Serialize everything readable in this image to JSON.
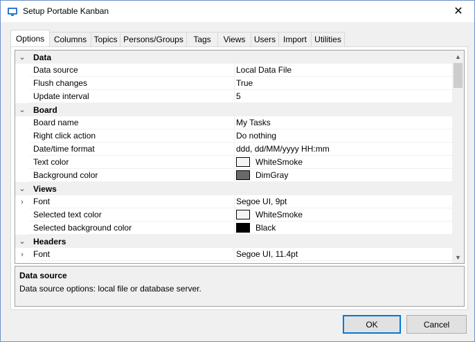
{
  "window": {
    "title": "Setup Portable Kanban",
    "close_glyph": "✕"
  },
  "tabs": [
    {
      "label": "Options"
    },
    {
      "label": "Columns"
    },
    {
      "label": "Topics"
    },
    {
      "label": "Persons/Groups"
    },
    {
      "label": "Tags"
    },
    {
      "label": "Views"
    },
    {
      "label": "Users"
    },
    {
      "label": "Import"
    },
    {
      "label": "Utilities"
    }
  ],
  "grid": {
    "rows": [
      {
        "type": "category",
        "expand_glyph": "⌄",
        "name": "Data"
      },
      {
        "type": "prop",
        "name": "Data source",
        "value": "Local Data File"
      },
      {
        "type": "prop",
        "name": "Flush changes",
        "value": "True"
      },
      {
        "type": "prop",
        "name": "Update interval",
        "value": "5"
      },
      {
        "type": "category",
        "expand_glyph": "⌄",
        "name": "Board"
      },
      {
        "type": "prop",
        "name": "Board name",
        "value": "My Tasks"
      },
      {
        "type": "prop",
        "name": "Right click action",
        "value": "Do nothing"
      },
      {
        "type": "prop",
        "name": "Date/time format",
        "value": "ddd, dd/MM/yyyy HH:mm"
      },
      {
        "type": "prop",
        "name": "Text color",
        "value": "WhiteSmoke",
        "swatch": "#f5f5f5"
      },
      {
        "type": "prop",
        "name": "Background color",
        "value": "DimGray",
        "swatch": "#696969"
      },
      {
        "type": "category",
        "expand_glyph": "⌄",
        "name": "Views"
      },
      {
        "type": "prop",
        "expandable": true,
        "expand_glyph": "›",
        "name": "Font",
        "value": "Segoe UI, 9pt"
      },
      {
        "type": "prop",
        "name": "Selected text color",
        "value": "WhiteSmoke",
        "swatch": "#f5f5f5"
      },
      {
        "type": "prop",
        "name": "Selected background color",
        "value": "Black",
        "swatch": "#000000"
      },
      {
        "type": "category",
        "expand_glyph": "⌄",
        "name": "Headers"
      },
      {
        "type": "prop",
        "expandable": true,
        "expand_glyph": "›",
        "name": "Font",
        "value": "Segoe UI, 11.4pt"
      }
    ]
  },
  "help": {
    "title": "Data source",
    "description": "Data source options: local file or database server."
  },
  "buttons": {
    "ok": "OK",
    "cancel": "Cancel"
  },
  "colors": {
    "accent": "#0078d7",
    "category_bg": "#f0f0f0"
  }
}
